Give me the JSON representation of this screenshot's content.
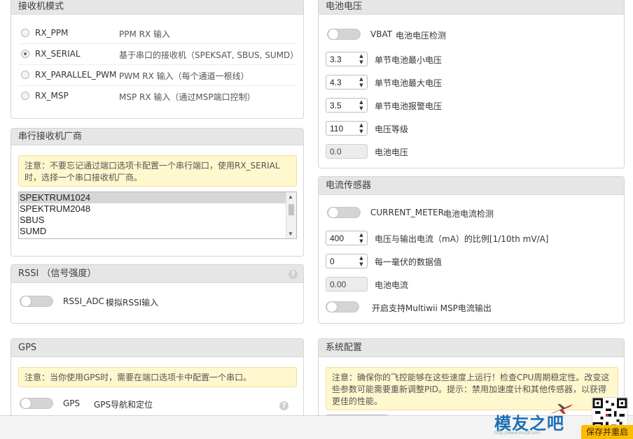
{
  "receiver_mode": {
    "title": "接收机模式",
    "options": [
      {
        "name": "RX_PPM",
        "desc": "PPM RX 输入",
        "selected": false
      },
      {
        "name": "RX_SERIAL",
        "desc": "基于串口的接收机（SPEKSAT, SBUS, SUMD）",
        "selected": true
      },
      {
        "name": "RX_PARALLEL_PWM",
        "desc": "PWM RX 输入（每个通道一根线）",
        "selected": false
      },
      {
        "name": "RX_MSP",
        "desc": "MSP RX 输入（通过MSP端口控制）",
        "selected": false
      }
    ]
  },
  "serial_receiver": {
    "title": "串行接收机厂商",
    "note": "注意：不要忘记通过端口选项卡配置一个串行端口，使用RX_SERIAL时，选择一个串口接收机厂商。",
    "providers": [
      "SPEKTRUM1024",
      "SPEKTRUM2048",
      "SBUS",
      "SUMD"
    ],
    "selected": "SPEKTRUM1024"
  },
  "rssi": {
    "title": "RSSI （信号强度）",
    "toggle_name": "RSSI_ADC",
    "toggle_desc": "模拟RSSI输入",
    "enabled": false
  },
  "gps": {
    "title": "GPS",
    "note": "注意：当你使用GPS时，需要在端口选项卡中配置一个串口。",
    "toggle_name": "GPS",
    "toggle_desc": "GPS导航和定位",
    "enabled": false
  },
  "battery_voltage": {
    "title": "电池电压",
    "vbat_name": "VBAT",
    "vbat_desc": "电池电压检测",
    "vbat_enabled": false,
    "fields": [
      {
        "value": "3.3",
        "label": "单节电池最小电压"
      },
      {
        "value": "4.3",
        "label": "单节电池最大电压"
      },
      {
        "value": "3.5",
        "label": "单节电池报警电压"
      },
      {
        "value": "110",
        "label": "电压等级"
      }
    ],
    "voltage_value": "0.0",
    "voltage_label": "电池电压"
  },
  "current_sensor": {
    "title": "电流传感器",
    "meter_name": "CURRENT_METER",
    "meter_desc": "电池电流检测",
    "meter_enabled": false,
    "fields": [
      {
        "value": "400",
        "label": "电压与输出电流（mA）的比例[1/10th mV/A]"
      },
      {
        "value": "0",
        "label": "每一毫伏的数据值"
      }
    ],
    "current_value": "0.00",
    "current_label": "电池电流",
    "msp_label": "开启支持Multiwii MSP电流输出",
    "msp_enabled": false
  },
  "system_config": {
    "title": "系统配置",
    "note": "注意：确保你的飞控能够在这些速度上运行！检查CPU周期稳定性。改变这些参数可能需要重新调整PID。提示：禁用加速度计和其他传感器，以获得更佳的性能。"
  },
  "icons": {
    "help": "?",
    "spin_up": "▲",
    "spin_down": "▼",
    "scroll_up": "▲",
    "scroll_down": "▼"
  },
  "watermark": {
    "text": "模友之吧",
    "sub": "http://www.moz8.com"
  },
  "save_button": "保存并重启"
}
